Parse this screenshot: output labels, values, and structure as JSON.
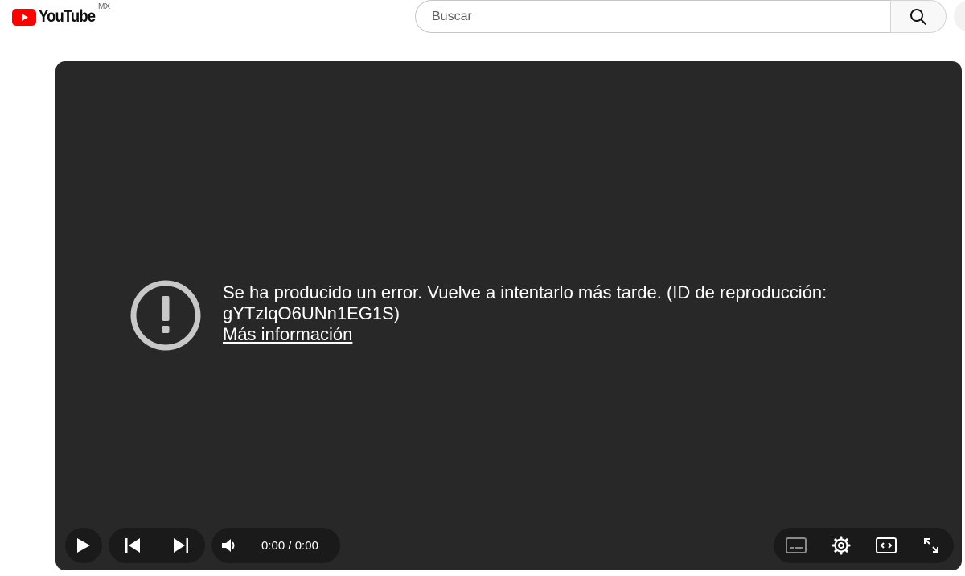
{
  "header": {
    "logo_text": "YouTube",
    "country_code": "MX",
    "search_placeholder": "Buscar",
    "search_value": ""
  },
  "player": {
    "error_message": "Se ha producido un error. Vuelve a intentarlo más tarde. (ID de reproducción: gYTzlqO6UNn1EG1S)",
    "more_info_link": "Más información",
    "time_current": "0:00",
    "time_separator": " / ",
    "time_total": "0:00",
    "controls": {
      "left": [
        "play-icon",
        "previous-icon",
        "next-icon",
        "volume-icon"
      ],
      "right": [
        "subtitles-icon",
        "settings-icon",
        "theater-mode-icon",
        "fullscreen-icon"
      ]
    }
  },
  "colors": {
    "brand_red": "#ff0000",
    "player_background": "#282828",
    "text_dark": "#0f0f0f"
  }
}
